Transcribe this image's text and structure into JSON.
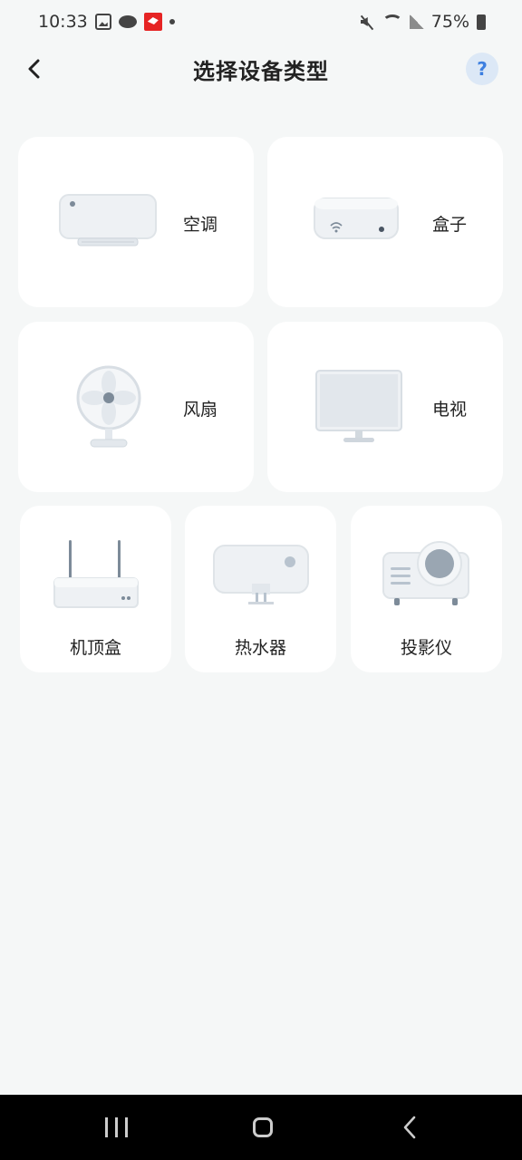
{
  "status_bar": {
    "time": "10:33",
    "battery": "75%",
    "icons": [
      "photo-icon",
      "cloud-icon",
      "app-icon",
      "dot-icon",
      "mute-icon",
      "wifi-icon",
      "signal-icon",
      "battery-icon"
    ]
  },
  "header": {
    "title": "选择设备类型",
    "help": "?"
  },
  "devices_large": [
    {
      "label": "空调",
      "icon": "air-conditioner-icon"
    },
    {
      "label": "盒子",
      "icon": "box-icon"
    },
    {
      "label": "风扇",
      "icon": "fan-icon"
    },
    {
      "label": "电视",
      "icon": "tv-icon"
    }
  ],
  "devices_small": [
    {
      "label": "机顶盒",
      "icon": "set-top-box-icon"
    },
    {
      "label": "热水器",
      "icon": "water-heater-icon"
    },
    {
      "label": "投影仪",
      "icon": "projector-icon"
    }
  ],
  "colors": {
    "background": "#f5f7f7",
    "card": "#ffffff",
    "help_bg": "#dce8f6",
    "help_fg": "#3d7fe0"
  }
}
